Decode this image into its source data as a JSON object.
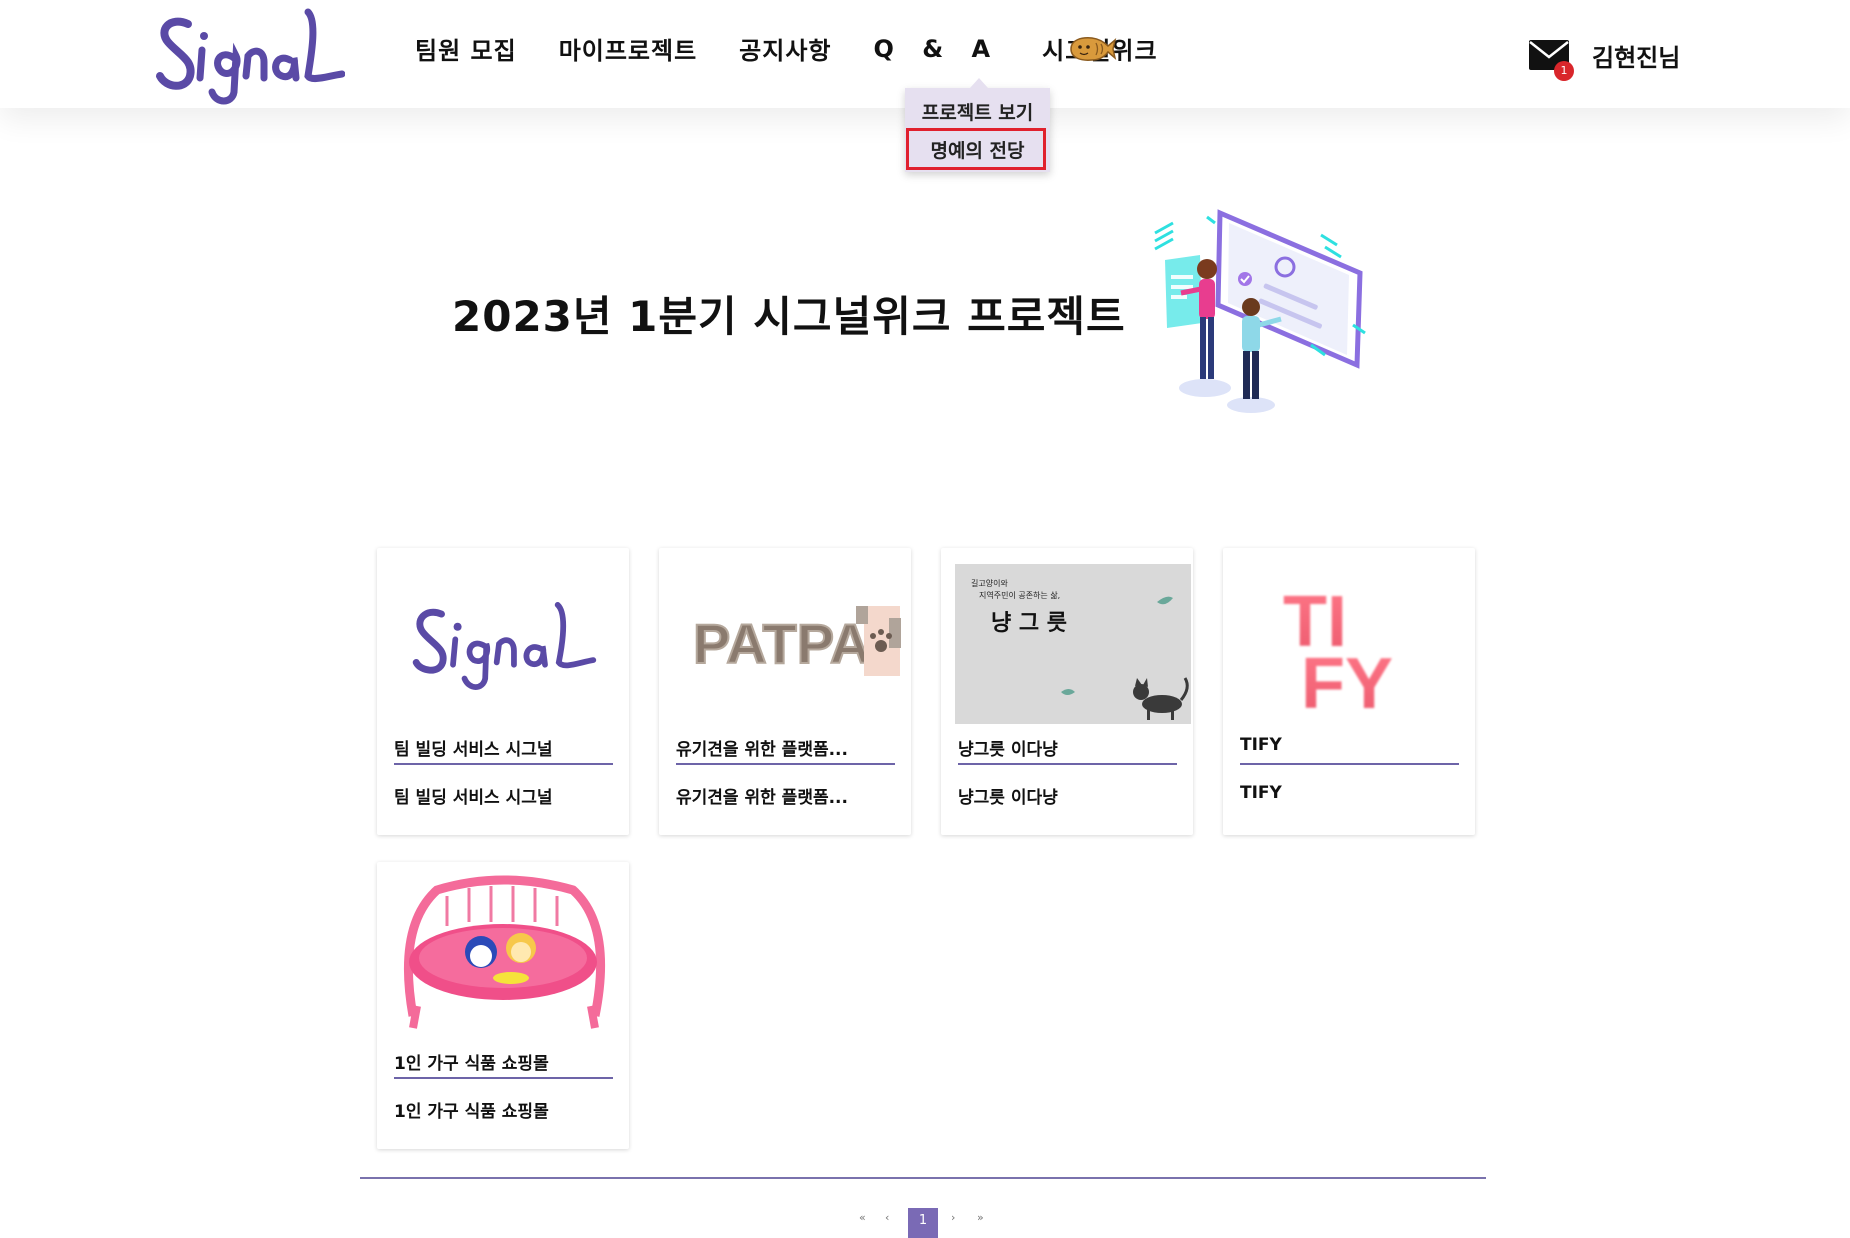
{
  "header": {
    "logo_text": "Signal",
    "nav": [
      {
        "label": "팀원 모집"
      },
      {
        "label": "마이프로젝트"
      },
      {
        "label": "공지사항"
      },
      {
        "label": "Q & A"
      },
      {
        "label": "시그널위크"
      }
    ],
    "fish_icon": "bungeoppang-icon",
    "mail_badge": "1",
    "user_name": "김현진님"
  },
  "dropdown": {
    "items": [
      {
        "label": "프로젝트 보기"
      },
      {
        "label": "명예의 전당"
      }
    ],
    "highlight_color": "#e0202e"
  },
  "hero": {
    "title": "2023년 1분기 시그널위크 프로젝트"
  },
  "cards": [
    {
      "image": "signal-logo",
      "title": "팀 빌딩 서비스 시그널",
      "desc": "팀 빌딩 서비스 시그널"
    },
    {
      "image": "patpat-logo",
      "image_text": "PATPAT",
      "title": "유기견을 위한 플랫폼...",
      "desc": "유기견을 위한 플랫폼..."
    },
    {
      "image": "nyangroot-banner",
      "image_line1": "길고양이와",
      "image_line2": "지역주민이 공존하는 삶,",
      "image_heading": "냥 그 릇",
      "title": "냥그릇 이다냥",
      "desc": "냥그릇 이다냥"
    },
    {
      "image": "tify-logo",
      "image_line1": "TI",
      "image_line2": "FY",
      "title": "TIFY",
      "desc": "TIFY"
    },
    {
      "image": "pink-kids-chair",
      "title": "1인 가구 식품 쇼핑몰",
      "desc": "1인 가구 식품 쇼핑몰"
    }
  ],
  "pagination": {
    "first": "«",
    "prev": "‹",
    "current": "1",
    "next": "›",
    "last": "»"
  },
  "colors": {
    "brand_purple": "#5a4aa6",
    "card_line": "#6d64a8",
    "dropdown_bg": "#e6e0f0",
    "badge_red": "#d9262b"
  }
}
